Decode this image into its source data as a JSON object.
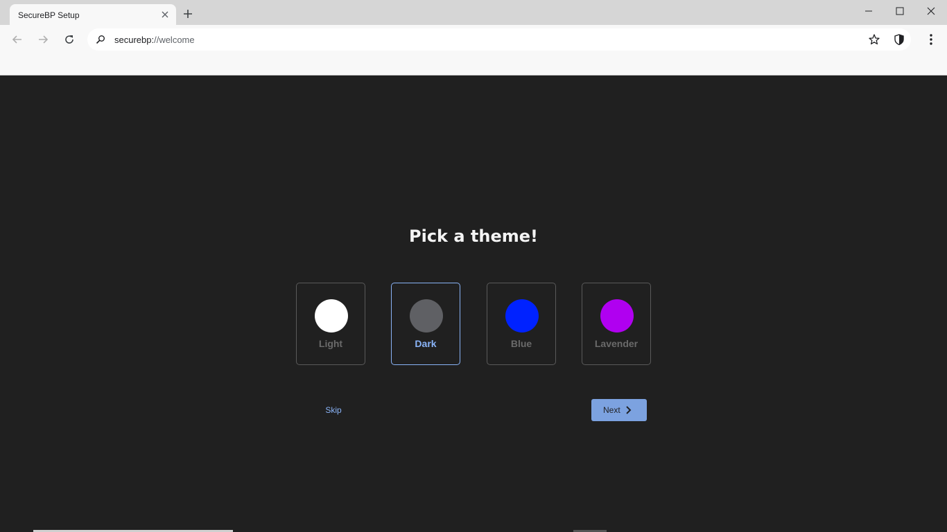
{
  "browser": {
    "tab_title": "SecureBP Setup",
    "url_scheme": "securebp:",
    "url_rest": "//welcome"
  },
  "icons": {
    "tab_close": "close-icon",
    "new_tab": "plus-icon",
    "minimize": "minimize-icon",
    "maximize": "maximize-icon",
    "close_window": "close-icon",
    "back": "arrow-left-icon",
    "forward": "arrow-right-icon",
    "reload": "reload-icon",
    "search": "search-icon",
    "bookmark": "star-icon",
    "shield": "shield-icon",
    "menu": "kebab-menu-icon",
    "next": "chevron-right-icon"
  },
  "page": {
    "heading": "Pick a theme!",
    "themes": [
      {
        "label": "Light",
        "color": "#ffffff",
        "selected": false
      },
      {
        "label": "Dark",
        "color": "#5f6064",
        "selected": true
      },
      {
        "label": "Blue",
        "color": "#0022ff",
        "selected": false
      },
      {
        "label": "Lavender",
        "color": "#b000f0",
        "selected": false
      }
    ],
    "skip_label": "Skip",
    "next_label": "Next"
  },
  "colors": {
    "background": "#202020",
    "accent": "#8ab4f8",
    "next_button": "#7ca2e0"
  }
}
